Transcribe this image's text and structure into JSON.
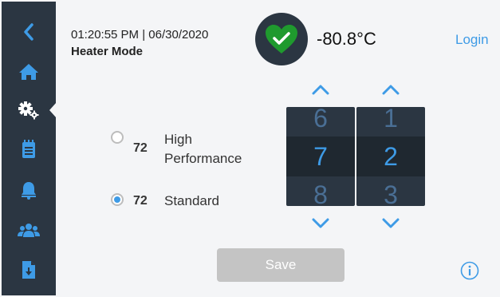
{
  "header": {
    "datetime": "01:20:55 PM | 06/30/2020",
    "mode": "Heater Mode",
    "temperature": "-80.8°C",
    "login_label": "Login",
    "status_icon": "heart-check-icon"
  },
  "sidebar": {
    "items": [
      {
        "name": "back",
        "icon": "chevron-left-icon"
      },
      {
        "name": "home",
        "icon": "home-icon"
      },
      {
        "name": "settings",
        "icon": "gears-icon",
        "active": true
      },
      {
        "name": "log",
        "icon": "notepad-icon"
      },
      {
        "name": "alarms",
        "icon": "bell-icon"
      },
      {
        "name": "users",
        "icon": "users-icon"
      },
      {
        "name": "export",
        "icon": "file-download-icon"
      }
    ]
  },
  "options": [
    {
      "value": "72",
      "label_line1": "High",
      "label_line2": "Performance",
      "selected": false
    },
    {
      "value": "72",
      "label": "Standard",
      "selected": true
    }
  ],
  "pickers": [
    {
      "prev": "6",
      "current": "7",
      "next": "8"
    },
    {
      "prev": "1",
      "current": "2",
      "next": "3"
    }
  ],
  "save_label": "Save",
  "colors": {
    "accent": "#3e9be6",
    "sidebar": "#2b3642",
    "status_green": "#1f9a2e",
    "disabled": "#c4c4c4"
  }
}
